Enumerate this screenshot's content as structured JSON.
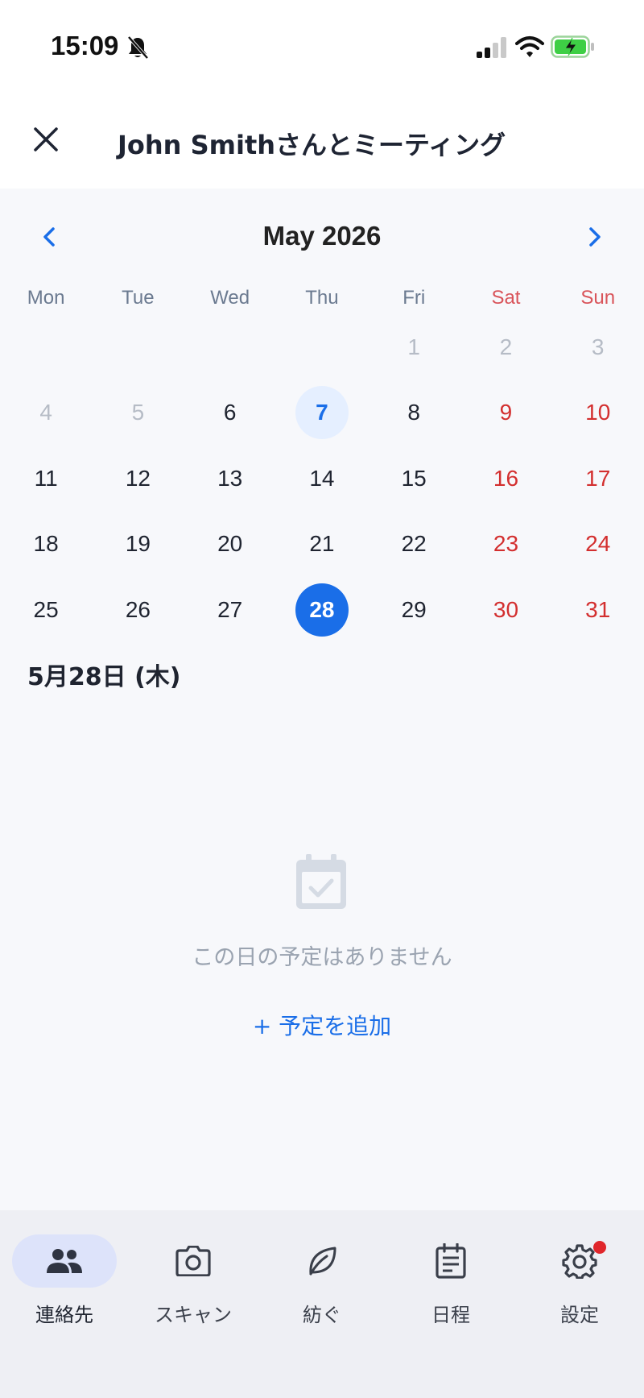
{
  "status_bar": {
    "time": "15:09"
  },
  "header": {
    "title": "John Smithさんとミーティング"
  },
  "calendar": {
    "month_label": "May 2026",
    "weekdays": [
      "Mon",
      "Tue",
      "Wed",
      "Thu",
      "Fri",
      "Sat",
      "Sun"
    ],
    "days": [
      {
        "d": "",
        "muted": false,
        "weekend": false
      },
      {
        "d": "",
        "muted": false,
        "weekend": false
      },
      {
        "d": "",
        "muted": false,
        "weekend": false
      },
      {
        "d": "",
        "muted": false,
        "weekend": false
      },
      {
        "d": "1",
        "muted": true,
        "weekend": false
      },
      {
        "d": "2",
        "muted": true,
        "weekend": true
      },
      {
        "d": "3",
        "muted": true,
        "weekend": true
      },
      {
        "d": "4",
        "muted": true,
        "weekend": false
      },
      {
        "d": "5",
        "muted": true,
        "weekend": false
      },
      {
        "d": "6",
        "muted": false,
        "weekend": false
      },
      {
        "d": "7",
        "muted": false,
        "weekend": false,
        "today": true
      },
      {
        "d": "8",
        "muted": false,
        "weekend": false
      },
      {
        "d": "9",
        "muted": false,
        "weekend": true
      },
      {
        "d": "10",
        "muted": false,
        "weekend": true
      },
      {
        "d": "11",
        "muted": false,
        "weekend": false
      },
      {
        "d": "12",
        "muted": false,
        "weekend": false
      },
      {
        "d": "13",
        "muted": false,
        "weekend": false
      },
      {
        "d": "14",
        "muted": false,
        "weekend": false
      },
      {
        "d": "15",
        "muted": false,
        "weekend": false
      },
      {
        "d": "16",
        "muted": false,
        "weekend": true
      },
      {
        "d": "17",
        "muted": false,
        "weekend": true
      },
      {
        "d": "18",
        "muted": false,
        "weekend": false
      },
      {
        "d": "19",
        "muted": false,
        "weekend": false
      },
      {
        "d": "20",
        "muted": false,
        "weekend": false
      },
      {
        "d": "21",
        "muted": false,
        "weekend": false
      },
      {
        "d": "22",
        "muted": false,
        "weekend": false
      },
      {
        "d": "23",
        "muted": false,
        "weekend": true
      },
      {
        "d": "24",
        "muted": false,
        "weekend": true
      },
      {
        "d": "25",
        "muted": false,
        "weekend": false
      },
      {
        "d": "26",
        "muted": false,
        "weekend": false
      },
      {
        "d": "27",
        "muted": false,
        "weekend": false
      },
      {
        "d": "28",
        "muted": false,
        "weekend": false,
        "selected": true
      },
      {
        "d": "29",
        "muted": false,
        "weekend": false
      },
      {
        "d": "30",
        "muted": false,
        "weekend": true
      },
      {
        "d": "31",
        "muted": false,
        "weekend": true
      }
    ]
  },
  "selected_date_label": "5月28日 (木)",
  "empty_state": {
    "icon": "calendar-check-icon",
    "message": "この日の予定はありません",
    "add_label": "+ 予定を追加"
  },
  "bottom_nav": {
    "items": [
      {
        "label": "連絡先",
        "icon": "people-icon",
        "active": true
      },
      {
        "label": "スキャン",
        "icon": "camera-icon",
        "active": false
      },
      {
        "label": "紡ぐ",
        "icon": "leaf-icon",
        "active": false
      },
      {
        "label": "日程",
        "icon": "schedule-icon",
        "active": false
      },
      {
        "label": "設定",
        "icon": "gear-icon",
        "active": false,
        "badge": true
      }
    ]
  },
  "colors": {
    "accent": "#1a6ee8",
    "weekend": "#d32f2f",
    "muted": "#b6bcc6",
    "badge": "#e0262b"
  }
}
